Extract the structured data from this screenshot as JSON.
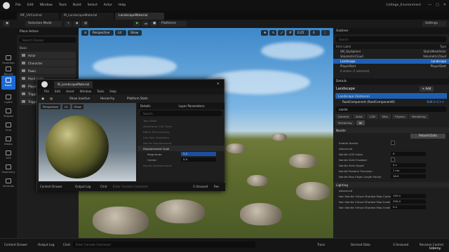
{
  "menubar": {
    "items": [
      "File",
      "Edit",
      "Window",
      "Tools",
      "Build",
      "Select",
      "Actor",
      "Help"
    ],
    "project": "Cottage_Environment"
  },
  "tabs": [
    "MF_UVControl",
    "M_LandscapeMaterial",
    "LandscapeMaterial"
  ],
  "toolbar": {
    "mode": "Selection Mode",
    "platforms": "Platforms",
    "settings": "Settings"
  },
  "rail": [
    {
      "label": "Favorites",
      "icon": "star-icon"
    },
    {
      "label": "Recent",
      "icon": "clock-icon"
    },
    {
      "label": "Basic",
      "icon": "cube-icon"
    },
    {
      "label": "Lights",
      "icon": "bulb-icon"
    },
    {
      "label": "Shapes",
      "icon": "shapes-icon"
    },
    {
      "label": "Cine",
      "icon": "camera-icon"
    },
    {
      "label": "Media",
      "icon": "media-icon"
    },
    {
      "label": "VFX",
      "icon": "vfx-icon"
    },
    {
      "label": "Geometry",
      "icon": "geometry-icon"
    },
    {
      "label": "Volumes",
      "icon": "volume-icon"
    }
  ],
  "place": {
    "title": "Place Actors",
    "search": "Search Classes",
    "section": "Basic",
    "items": [
      "Actor",
      "Character",
      "Pawn",
      "Point Light",
      "Player Start",
      "Trigger Box",
      "Trigger Sphere"
    ]
  },
  "viewport": {
    "perspective": "Perspective",
    "lit": "Lit",
    "show": "Show",
    "speed": "0.25",
    "cam": "4"
  },
  "outliner": {
    "title": "Outliner",
    "search": "Search",
    "col_label": "Item Label",
    "col_type": "Type",
    "rows": [
      {
        "label": "SM_SkySphere",
        "type": "StaticMeshActor"
      },
      {
        "label": "VolumetricCloud",
        "type": "VolumetricCloud"
      },
      {
        "label": "Landscape",
        "type": "Landscape"
      },
      {
        "label": "PlayerStart",
        "type": "PlayerStart"
      }
    ],
    "count": "6 actors (1 selected)"
  },
  "details": {
    "title": "Details",
    "actor": "Landscape",
    "add": "+ Add",
    "instance": "Landscape (Instance)",
    "root": "RootComponent (RootComponent0)",
    "edit_in": "Edit in C++",
    "search": "nanite",
    "filters": [
      "General",
      "Actor",
      "LOD",
      "Misc",
      "Physics",
      "Rendering",
      "Streaming",
      "All"
    ],
    "nanite_cat": "Nanite",
    "rebuild": "Rebuild Data",
    "props": [
      {
        "name": "Enable Nanite",
        "value": ""
      },
      {
        "name": "Advanced",
        "value": ""
      },
      {
        "name": "Nanite LOD Index",
        "value": "0"
      },
      {
        "name": "Nanite Skirt Enabled",
        "value": ""
      },
      {
        "name": "Nanite Skirt Depth",
        "value": "0.1"
      },
      {
        "name": "Nanite Position Precision",
        "value": "1 cm"
      },
      {
        "name": "Nanite Max Edge Length Factor",
        "value": "16.0"
      }
    ],
    "lighting_cat": "Lighting",
    "lighting_adv": "Advanced",
    "lprops": [
      {
        "name": "Non Nanite Virtual Shadow Map Const",
        "value": "150.0"
      },
      {
        "name": "Non Nanite Virtual Shadow Map Invali",
        "value": "250.0"
      },
      {
        "name": "Non Nanite Virtual Shadow Map Invali",
        "value": "0.2"
      }
    ]
  },
  "mated": {
    "tab": "M_LandscapeMaterial",
    "menu": [
      "File",
      "Edit",
      "Asset",
      "Window",
      "Tools",
      "Help"
    ],
    "show_inactive": "Show Inactive",
    "hierarchy": "Hierarchy",
    "platform_stats": "Platform Stats",
    "vp_persp": "Perspective",
    "vp_lit": "Lit",
    "vp_show": "Show",
    "details_tab": "Details",
    "layer_params": "Layer Parameters",
    "search": "Search",
    "rows": [
      "Two Sided",
      "Wireframe LOD Trans",
      "Blend Translucency",
      "Use Post Distortion",
      "Nanite Displacement",
      "Displacement Scali",
      "Magnitude",
      "Center",
      "Nanite Displacement"
    ],
    "magnitude": "5.0",
    "center": "0.0",
    "content_drawer": "Content Drawer",
    "output_log": "Output Log",
    "cmd": "Cmd",
    "console": "Enter Console Command",
    "unsaved": "3 Unsaved",
    "rev": "Rev"
  },
  "status": {
    "content_drawer": "Content Drawer",
    "output_log": "Output Log",
    "cmd": "Cmd",
    "console": "Enter Console Command",
    "trace": "Trace",
    "derived": "Derived Data",
    "unsaved": "3 Unsaved",
    "revision": "Revision Control",
    "udemy": "Udemy"
  }
}
